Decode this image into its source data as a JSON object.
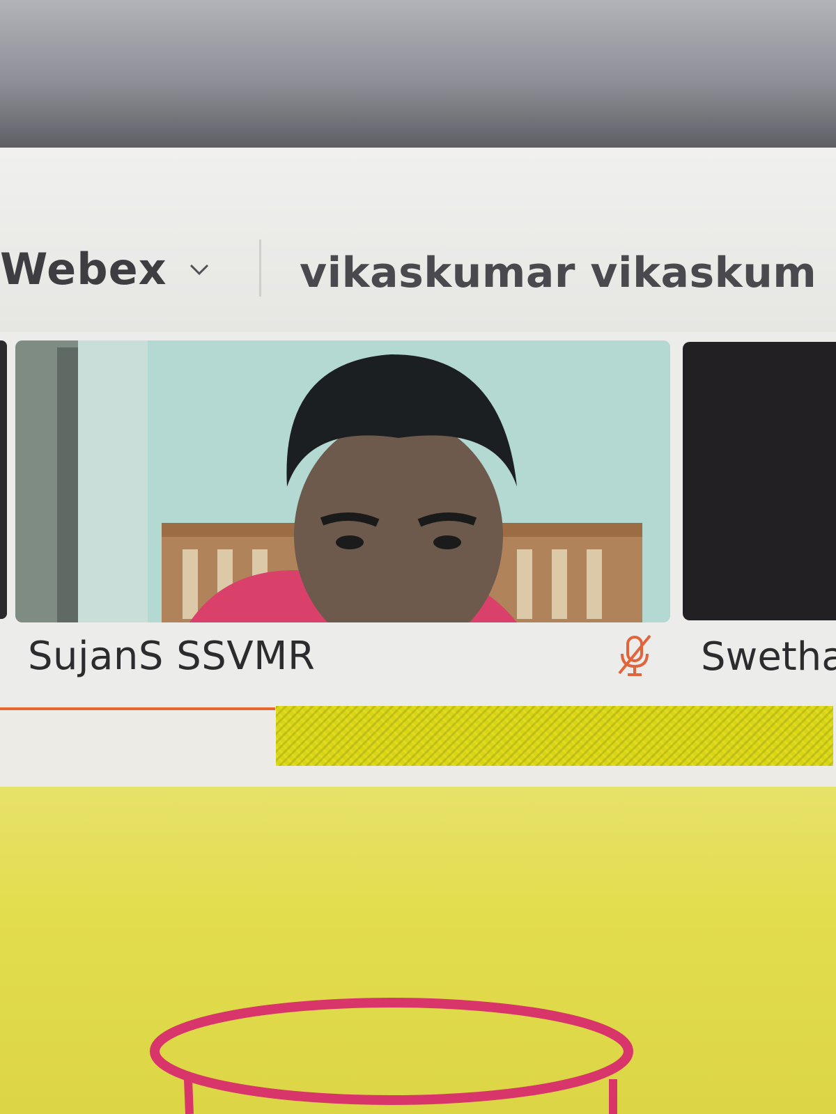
{
  "header": {
    "app_name": "Webex",
    "meeting_title": "vikaskumar vikaskum"
  },
  "participants": [
    {
      "name": "SujanS SSVMR",
      "muted": true
    },
    {
      "name": "Swetha"
    }
  ],
  "colors": {
    "accent_orange": "#e9672c",
    "highlight_yellow": "#d8d416",
    "whiteboard_yellow": "#e2dd4c",
    "drawing_pink": "#d8356b"
  },
  "icons": [
    "chevron-down-icon",
    "microphone-muted-icon"
  ]
}
